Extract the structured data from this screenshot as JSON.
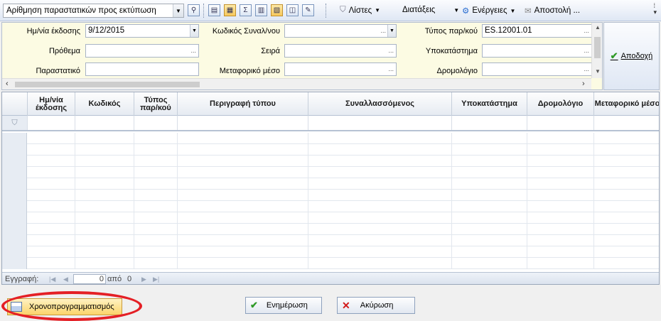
{
  "toolbar": {
    "print_numbering_select": "Αρίθμηση  παραστατικών προς εκτύπωση",
    "menus": {
      "lists": "Λίστες",
      "commands": "Διατάξεις",
      "actions": "Ενέργειες",
      "send": "Αποστολή ..."
    }
  },
  "form": {
    "issue_date_label": "Ημ/νία έκδοσης",
    "issue_date_value": "9/12/2015",
    "prefix_label": "Πρόθεμα",
    "prefix_value": "",
    "document_label": "Παραστατικό",
    "document_value": "",
    "partner_code_label": "Κωδικός Συναλ/νου",
    "partner_code_value": "",
    "series_label": "Σειρά",
    "series_value": "",
    "transport_label": "Μεταφορικό μέσο",
    "transport_value": "",
    "doc_type_label": "Τύπος παρ/κού",
    "doc_type_value": "ES.12001.01",
    "branch_label": "Υποκατάστημα",
    "branch_value": "",
    "route_label": "Δρομολόγιο",
    "route_value": "",
    "accept_label": "Αποδοχή"
  },
  "grid": {
    "columns": [
      "Ημ/νία έκδοσης",
      "Κωδικός",
      "Τύπος παρ/κού",
      "Περιγραφή τύπου",
      "Συναλλασσόμενος",
      "Υποκατάστημα",
      "Δρομολόγιο",
      "Μεταφορικό μέσο"
    ],
    "rows": []
  },
  "navigator": {
    "record_label": "Εγγραφή:",
    "current": "0",
    "of_label": "από",
    "total": "0"
  },
  "buttons": {
    "schedule": "Χρονοπρογραμματισμός",
    "update": "Ενημέρωση",
    "cancel": "Ακύρωση"
  }
}
